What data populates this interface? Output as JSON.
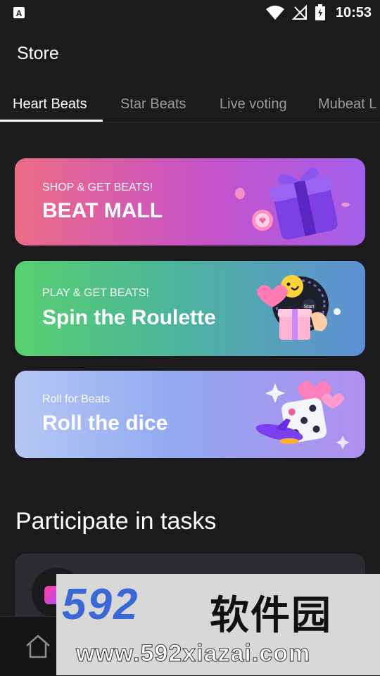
{
  "status_bar": {
    "time": "10:53",
    "icons": [
      "keyboard-a-icon",
      "wifi-icon",
      "no-signal-icon",
      "battery-charging-icon"
    ]
  },
  "header": {
    "title": "Store"
  },
  "tabs": [
    {
      "label": "Heart Beats",
      "active": true
    },
    {
      "label": "Star Beats",
      "active": false
    },
    {
      "label": "Live voting",
      "active": false
    },
    {
      "label": "Mubeat L",
      "active": false
    }
  ],
  "cards": [
    {
      "kicker": "SHOP & GET BEATS!",
      "title": "BEAT MALL",
      "icon": "gift-box-icon"
    },
    {
      "kicker": "PLAY & GET BEATS!",
      "title": "Spin the Roulette",
      "icon": "roulette-icon"
    },
    {
      "kicker": "Roll for Beats",
      "title": "Roll the dice",
      "icon": "dice-icon"
    }
  ],
  "tasks": {
    "title": "Participate in tasks"
  },
  "bottom_nav": {
    "items": [
      "home-icon"
    ]
  },
  "watermark": {
    "brand": "592",
    "cn": "软件园",
    "url": "www.592xiazai.com"
  },
  "colors": {
    "background": "#1b1b1d",
    "beat_mall_gradient": [
      "#ec6b87",
      "#a35fe9"
    ],
    "roulette_gradient": [
      "#58d06f",
      "#5f8fd6"
    ],
    "dice_gradient": [
      "#b6c7f4",
      "#b08ff0"
    ],
    "watermark_blue": "#3a68d6"
  }
}
